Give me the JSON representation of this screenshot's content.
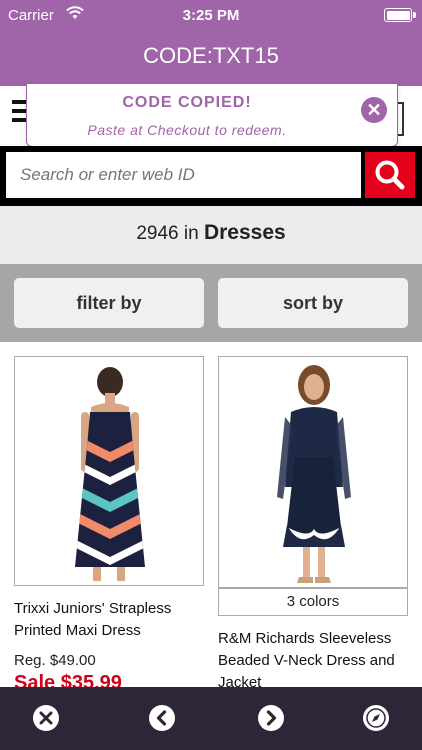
{
  "status": {
    "carrier": "Carrier",
    "time": "3:25 PM"
  },
  "promo": {
    "code_text": "CODE:TXT15"
  },
  "toast": {
    "title": "CODE COPIED!",
    "subtitle": "Paste at Checkout to redeem."
  },
  "search": {
    "placeholder": "Search or enter web ID"
  },
  "results": {
    "count": "2946",
    "in_text": "in",
    "category": "Dresses"
  },
  "controls": {
    "filter_label": "filter by",
    "sort_label": "sort by"
  },
  "products": [
    {
      "name_line1": "Trixxi Juniors' Strapless",
      "name_line2": "Printed Maxi Dress",
      "reg_price": "Reg. $49.00",
      "sale_price": "Sale $35.99"
    },
    {
      "colors": "3 colors",
      "name_line1": "R&M Richards Sleeveless",
      "name_line2": "Beaded V-Neck Dress and",
      "name_line3": "Jacket"
    }
  ],
  "nav": {
    "icons": [
      "close-icon",
      "back-icon",
      "forward-icon",
      "compass-icon"
    ]
  },
  "colors": {
    "brand_purple": "#a064a8",
    "search_red": "#e3001b",
    "sale_red": "#d0021b",
    "bottom_bar": "#2e2538"
  }
}
